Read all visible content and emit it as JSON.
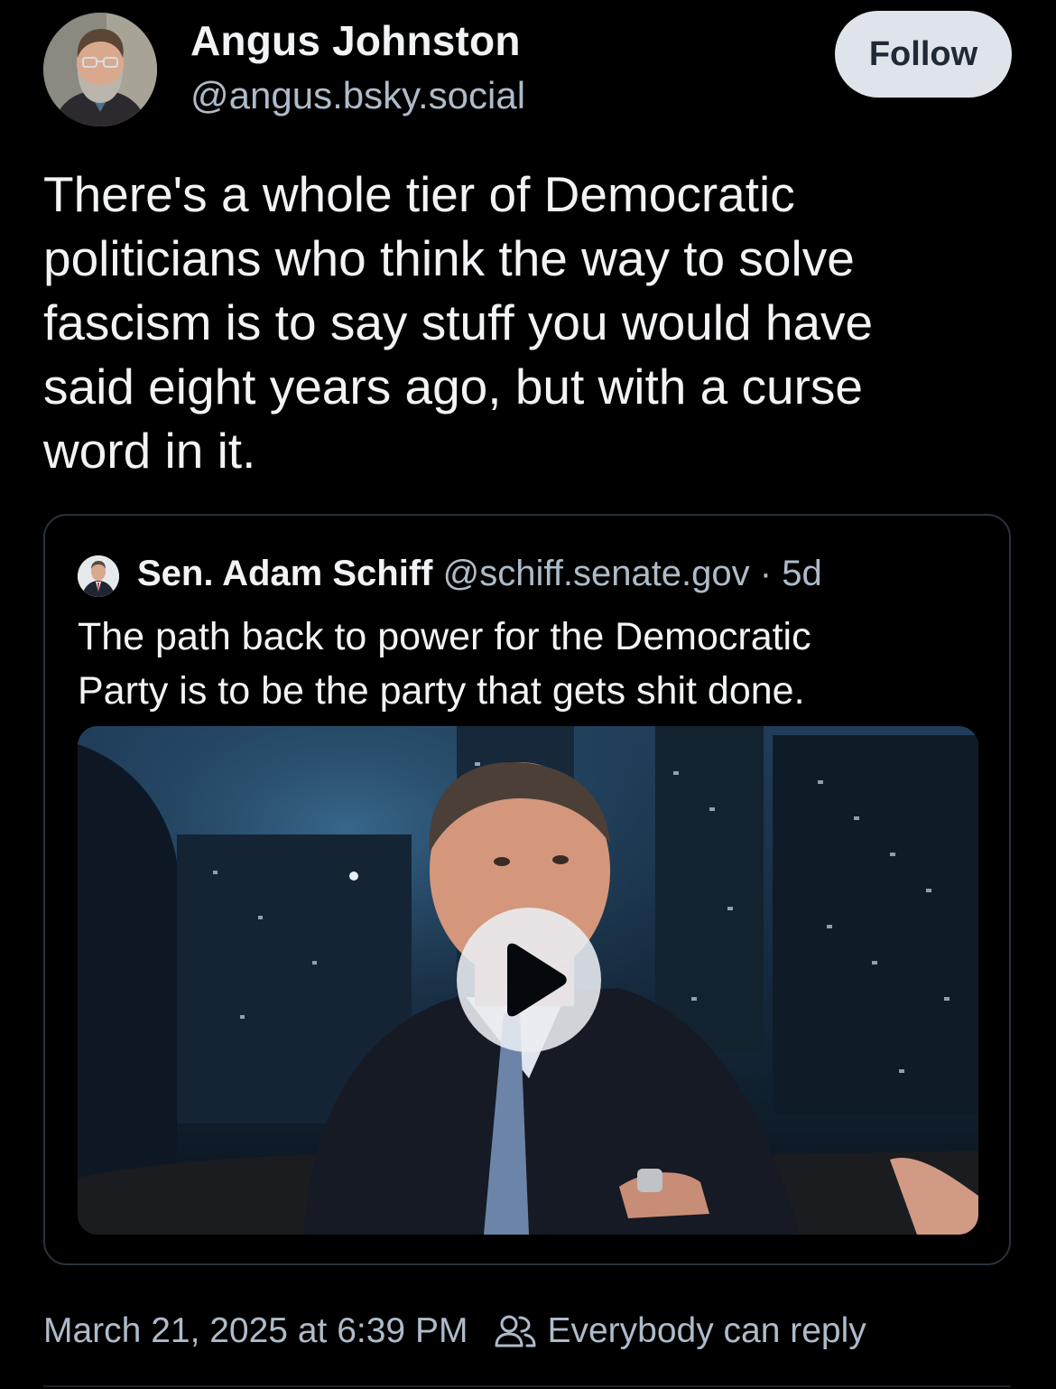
{
  "author": {
    "display_name": "Angus Johnston",
    "handle": "@angus.bsky.social",
    "avatar_icon": "avatar"
  },
  "follow_label": "Follow",
  "post": {
    "text": "There's a whole tier of Democratic\npoliticians who think the way to solve\nfascism is to say stuff you would have\nsaid eight years ago, but with a curse\nword in it."
  },
  "quote": {
    "author_name": "Sen. Adam Schiff",
    "author_handle": "@schiff.senate.gov",
    "separator": "·",
    "time": "5d",
    "text": "The path back to power for the Democratic\nParty is to be the party that gets shit done.",
    "video_icon": "play-icon"
  },
  "meta": {
    "timestamp": "March 21, 2025 at 6:39 PM",
    "reply_setting": "Everybody can reply",
    "reply_icon": "people-icon"
  },
  "colors": {
    "background": "#000000",
    "text": "#f1f3f5",
    "muted": "#aebbc9",
    "follow_bg": "#dfe4ea",
    "card_border": "#2a323c"
  }
}
